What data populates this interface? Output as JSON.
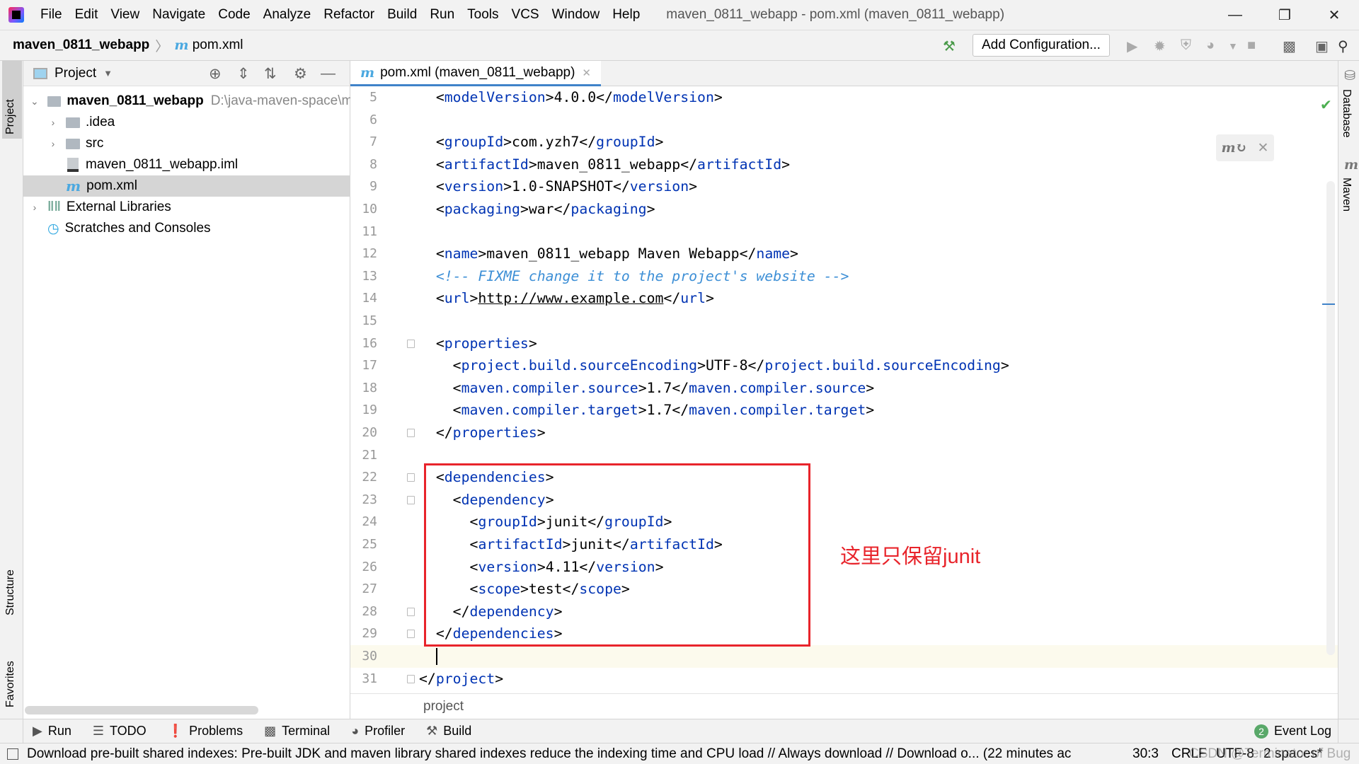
{
  "menubar": {
    "items": [
      "File",
      "Edit",
      "View",
      "Navigate",
      "Code",
      "Analyze",
      "Refactor",
      "Build",
      "Run",
      "Tools",
      "VCS",
      "Window",
      "Help"
    ],
    "title": "maven_0811_webapp - pom.xml (maven_0811_webapp)"
  },
  "navbar": {
    "project": "maven_0811_webapp",
    "file": "pom.xml",
    "add_config": "Add Configuration..."
  },
  "left_strip": {
    "project": "Project",
    "structure": "Structure",
    "favorites": "Favorites"
  },
  "right_strip": {
    "database": "Database",
    "maven": "Maven"
  },
  "project_panel": {
    "title": "Project",
    "tree": [
      {
        "label": "maven_0811_webapp",
        "path": "D:\\java-maven-space\\m",
        "bold": true,
        "expanded": true
      },
      {
        "label": ".idea",
        "kind": "folder"
      },
      {
        "label": "src",
        "kind": "folder"
      },
      {
        "label": "maven_0811_webapp.iml",
        "kind": "iml"
      },
      {
        "label": "pom.xml",
        "kind": "maven",
        "selected": true
      },
      {
        "label": "External Libraries",
        "kind": "libs"
      },
      {
        "label": "Scratches and Consoles",
        "kind": "scratch"
      }
    ]
  },
  "editor": {
    "tab": "pom.xml (maven_0811_webapp)",
    "current_line": 30,
    "cursor": "30:3",
    "lines": [
      {
        "n": 5,
        "i": 1,
        "s": [
          [
            "p",
            "<"
          ],
          [
            "t",
            "modelVersion"
          ],
          [
            "p",
            ">4.0.0</"
          ],
          [
            "t",
            "modelVersion"
          ],
          [
            "p",
            ">"
          ]
        ]
      },
      {
        "n": 6,
        "i": 0,
        "s": []
      },
      {
        "n": 7,
        "i": 1,
        "s": [
          [
            "p",
            "<"
          ],
          [
            "t",
            "groupId"
          ],
          [
            "p",
            ">com.yzh7</"
          ],
          [
            "t",
            "groupId"
          ],
          [
            "p",
            ">"
          ]
        ]
      },
      {
        "n": 8,
        "i": 1,
        "s": [
          [
            "p",
            "<"
          ],
          [
            "t",
            "artifactId"
          ],
          [
            "p",
            ">maven_0811_webapp</"
          ],
          [
            "t",
            "artifactId"
          ],
          [
            "p",
            ">"
          ]
        ]
      },
      {
        "n": 9,
        "i": 1,
        "s": [
          [
            "p",
            "<"
          ],
          [
            "t",
            "version"
          ],
          [
            "p",
            ">1.0-SNAPSHOT</"
          ],
          [
            "t",
            "version"
          ],
          [
            "p",
            ">"
          ]
        ]
      },
      {
        "n": 10,
        "i": 1,
        "s": [
          [
            "p",
            "<"
          ],
          [
            "t",
            "packaging"
          ],
          [
            "p",
            ">war</"
          ],
          [
            "t",
            "packaging"
          ],
          [
            "p",
            ">"
          ]
        ]
      },
      {
        "n": 11,
        "i": 0,
        "s": []
      },
      {
        "n": 12,
        "i": 1,
        "s": [
          [
            "p",
            "<"
          ],
          [
            "t",
            "name"
          ],
          [
            "p",
            ">maven_0811_webapp Maven Webapp</"
          ],
          [
            "t",
            "name"
          ],
          [
            "p",
            ">"
          ]
        ]
      },
      {
        "n": 13,
        "i": 1,
        "s": [
          [
            "c",
            "<!-- FIXME change it to the project's website -->"
          ]
        ]
      },
      {
        "n": 14,
        "i": 1,
        "s": [
          [
            "p",
            "<"
          ],
          [
            "t",
            "url"
          ],
          [
            "p",
            ">"
          ],
          [
            "u",
            "http://www.example.com"
          ],
          [
            "p",
            "</"
          ],
          [
            "t",
            "url"
          ],
          [
            "p",
            ">"
          ]
        ]
      },
      {
        "n": 15,
        "i": 0,
        "s": []
      },
      {
        "n": 16,
        "i": 1,
        "f": true,
        "s": [
          [
            "p",
            "<"
          ],
          [
            "t",
            "properties"
          ],
          [
            "p",
            ">"
          ]
        ]
      },
      {
        "n": 17,
        "i": 2,
        "s": [
          [
            "p",
            "<"
          ],
          [
            "t",
            "project.build.sourceEncoding"
          ],
          [
            "p",
            ">UTF-8</"
          ],
          [
            "t",
            "project.build.sourceEncoding"
          ],
          [
            "p",
            ">"
          ]
        ]
      },
      {
        "n": 18,
        "i": 2,
        "s": [
          [
            "p",
            "<"
          ],
          [
            "t",
            "maven.compiler.source"
          ],
          [
            "p",
            ">1.7</"
          ],
          [
            "t",
            "maven.compiler.source"
          ],
          [
            "p",
            ">"
          ]
        ]
      },
      {
        "n": 19,
        "i": 2,
        "s": [
          [
            "p",
            "<"
          ],
          [
            "t",
            "maven.compiler.target"
          ],
          [
            "p",
            ">1.7</"
          ],
          [
            "t",
            "maven.compiler.target"
          ],
          [
            "p",
            ">"
          ]
        ]
      },
      {
        "n": 20,
        "i": 1,
        "f": true,
        "s": [
          [
            "p",
            "</"
          ],
          [
            "t",
            "properties"
          ],
          [
            "p",
            ">"
          ]
        ]
      },
      {
        "n": 21,
        "i": 0,
        "s": []
      },
      {
        "n": 22,
        "i": 1,
        "f": true,
        "s": [
          [
            "p",
            "<"
          ],
          [
            "t",
            "dependencies"
          ],
          [
            "p",
            ">"
          ]
        ]
      },
      {
        "n": 23,
        "i": 2,
        "f": true,
        "s": [
          [
            "p",
            "<"
          ],
          [
            "t",
            "dependency"
          ],
          [
            "p",
            ">"
          ]
        ]
      },
      {
        "n": 24,
        "i": 3,
        "s": [
          [
            "p",
            "<"
          ],
          [
            "t",
            "groupId"
          ],
          [
            "p",
            ">junit</"
          ],
          [
            "t",
            "groupId"
          ],
          [
            "p",
            ">"
          ]
        ]
      },
      {
        "n": 25,
        "i": 3,
        "s": [
          [
            "p",
            "<"
          ],
          [
            "t",
            "artifactId"
          ],
          [
            "p",
            ">junit</"
          ],
          [
            "t",
            "artifactId"
          ],
          [
            "p",
            ">"
          ]
        ]
      },
      {
        "n": 26,
        "i": 3,
        "s": [
          [
            "p",
            "<"
          ],
          [
            "t",
            "version"
          ],
          [
            "p",
            ">4.11</"
          ],
          [
            "t",
            "version"
          ],
          [
            "p",
            ">"
          ]
        ]
      },
      {
        "n": 27,
        "i": 3,
        "s": [
          [
            "p",
            "<"
          ],
          [
            "t",
            "scope"
          ],
          [
            "p",
            ">test</"
          ],
          [
            "t",
            "scope"
          ],
          [
            "p",
            ">"
          ]
        ]
      },
      {
        "n": 28,
        "i": 2,
        "f": true,
        "s": [
          [
            "p",
            "</"
          ],
          [
            "t",
            "dependency"
          ],
          [
            "p",
            ">"
          ]
        ]
      },
      {
        "n": 29,
        "i": 1,
        "f": true,
        "s": [
          [
            "p",
            "</"
          ],
          [
            "t",
            "dependencies"
          ],
          [
            "p",
            ">"
          ]
        ]
      },
      {
        "n": 30,
        "i": 0,
        "s": []
      },
      {
        "n": 31,
        "i": 0,
        "f": true,
        "s": [
          [
            "p",
            "</"
          ],
          [
            "t",
            "project"
          ],
          [
            "p",
            ">"
          ]
        ]
      }
    ],
    "breadcrumb": "project",
    "annotation": "这里只保留junit"
  },
  "tool_windows": [
    "Run",
    "TODO",
    "Problems",
    "Terminal",
    "Profiler",
    "Build"
  ],
  "event_log": {
    "label": "Event Log",
    "count": "2"
  },
  "status": {
    "message": "Download pre-built shared indexes: Pre-built JDK and maven library shared indexes reduce the indexing time and CPU load // Always download // Download o... (22 minutes ac",
    "position": "30:3",
    "line_sep": "CRLF",
    "encoding": "UTF-8",
    "indent": "2 spaces*",
    "watermark": "CSDN @Terminator of Bug"
  },
  "colors": {
    "tag": "#0033b3",
    "comment": "#3d8fd6",
    "annotation": "#e8242b",
    "current_line": "#fcfaed"
  }
}
